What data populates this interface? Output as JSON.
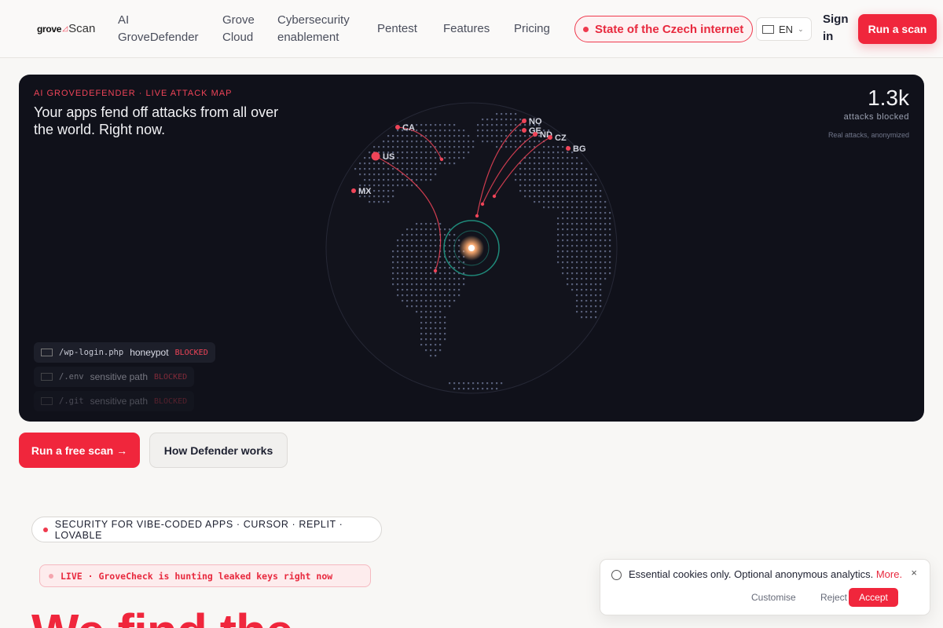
{
  "header": {
    "logo": {
      "brand": "grove",
      "product": "Scan"
    },
    "nav": [
      {
        "label": "AI GroveDefender"
      },
      {
        "label": "Grove Cloud"
      },
      {
        "label": "Cybersecurity enablement"
      },
      {
        "label": "Pentest"
      },
      {
        "label": "Features"
      },
      {
        "label": "Pricing"
      }
    ],
    "state_pill": "State of the Czech internet",
    "language": "EN",
    "sign_in": "Sign in",
    "run_scan": "Run a scan"
  },
  "panel": {
    "kicker": "AI GROVEDEFENDER · LIVE ATTACK MAP",
    "headline": "Your apps fend off attacks from all over the world. Right now.",
    "stat_value": "1.3k",
    "stat_label": "attacks blocked",
    "stat_note": "Real attacks, anonymized",
    "countries": [
      "CA",
      "US",
      "MX",
      "NO",
      "GE",
      "ND",
      "CZ",
      "BG"
    ],
    "log": [
      {
        "path": "/wp-login.php",
        "kind": "honeypot",
        "status": "BLOCKED"
      },
      {
        "path": "/.env",
        "kind": "sensitive path",
        "status": "BLOCKED"
      },
      {
        "path": "/.git",
        "kind": "sensitive path",
        "status": "BLOCKED"
      }
    ],
    "colors": {
      "attack": "#ef4458",
      "target_ring": "#1f8a7a",
      "target_core": "#f2a36b"
    }
  },
  "cta": {
    "primary": "Run a free scan →",
    "secondary": "How Defender works"
  },
  "badges": {
    "security": "SECURITY FOR VIBE-CODED APPS · CURSOR · REPLIT · LOVABLE",
    "live": "LIVE · GroveCheck is hunting leaked keys right now"
  },
  "hero": {
    "title": "We find the"
  },
  "cookie": {
    "text": "Essential cookies only. Optional anonymous analytics.",
    "more": "More.",
    "close": "×",
    "customise": "Customise",
    "reject": "Reject",
    "accept": "Accept"
  }
}
